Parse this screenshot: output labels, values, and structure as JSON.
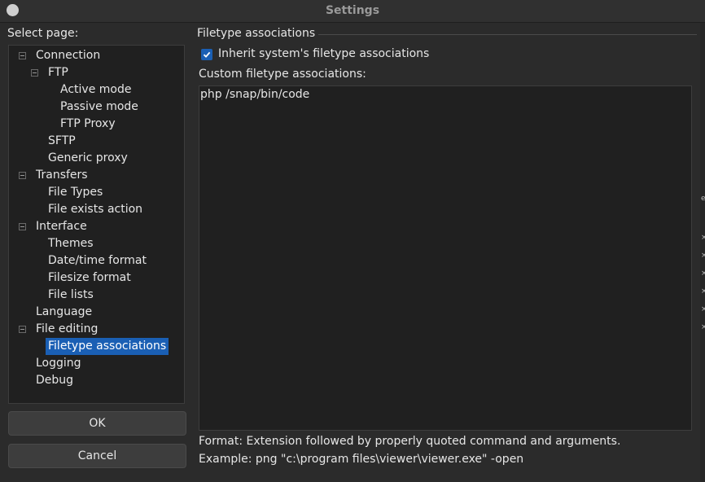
{
  "window": {
    "title": "Settings"
  },
  "sidebar": {
    "label": "Select page:",
    "items": [
      {
        "label": "Connection",
        "selected": false
      },
      {
        "label": "FTP",
        "selected": false
      },
      {
        "label": "Active mode",
        "selected": false
      },
      {
        "label": "Passive mode",
        "selected": false
      },
      {
        "label": "FTP Proxy",
        "selected": false
      },
      {
        "label": "SFTP",
        "selected": false
      },
      {
        "label": "Generic proxy",
        "selected": false
      },
      {
        "label": "Transfers",
        "selected": false
      },
      {
        "label": "File Types",
        "selected": false
      },
      {
        "label": "File exists action",
        "selected": false
      },
      {
        "label": "Interface",
        "selected": false
      },
      {
        "label": "Themes",
        "selected": false
      },
      {
        "label": "Date/time format",
        "selected": false
      },
      {
        "label": "Filesize format",
        "selected": false
      },
      {
        "label": "File lists",
        "selected": false
      },
      {
        "label": "Language",
        "selected": false
      },
      {
        "label": "File editing",
        "selected": false
      },
      {
        "label": "Filetype associations",
        "selected": true
      },
      {
        "label": "Logging",
        "selected": false
      },
      {
        "label": "Debug",
        "selected": false
      }
    ]
  },
  "buttons": {
    "ok": "OK",
    "cancel": "Cancel"
  },
  "panel": {
    "group_title": "Filetype associations",
    "inherit_label": "Inherit system's filetype associations",
    "inherit_checked": true,
    "custom_label": "Custom filetype associations:",
    "custom_value": "php /snap/bin/code",
    "format_help": "Format: Extension followed by properly quoted command and arguments.",
    "example_help": "Example: png \"c:\\program files\\viewer\\viewer.exe\" -open"
  },
  "colors": {
    "accent": "#1a5fb4",
    "background": "#2b2b2b",
    "field": "#202020",
    "text": "#e6e6e6"
  }
}
